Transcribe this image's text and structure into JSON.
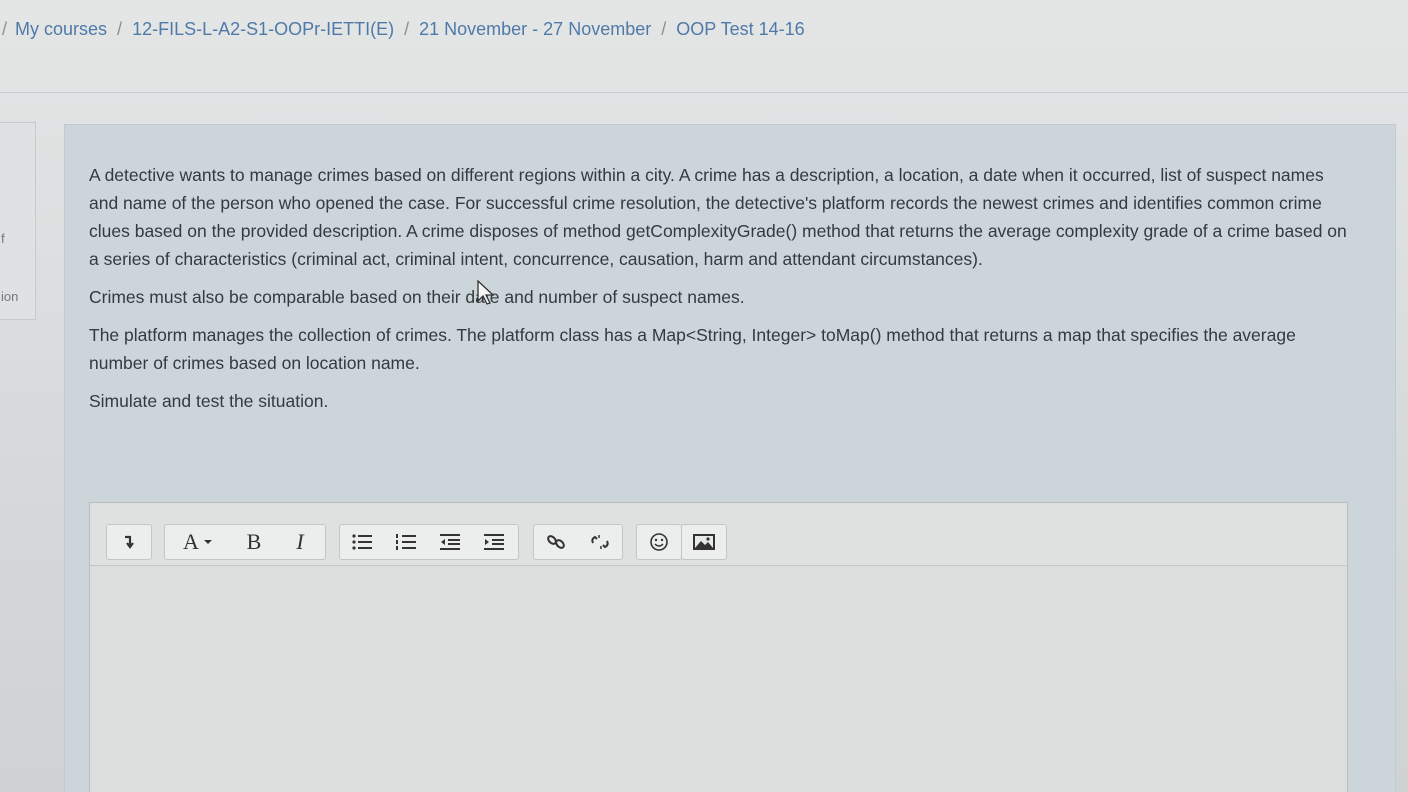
{
  "breadcrumb": {
    "items": [
      {
        "label": "My courses"
      },
      {
        "label": "12-FILS-L-A2-S1-OOPr-IETTI(E)"
      },
      {
        "label": "21 November - 27 November"
      },
      {
        "label": "OOP Test 14-16"
      }
    ],
    "separator": "/"
  },
  "sidebar_fragments": {
    "frag1": "f",
    "frag2": "ion"
  },
  "question": {
    "paragraphs": [
      "A detective wants to manage crimes based on different regions within a city. A crime has a description, a location, a date when it occurred, list of suspect names and name of the person who opened the case. For successful crime resolution, the detective's platform records the newest crimes and identifies common crime clues based on the provided description. A crime disposes of method getComplexityGrade() method that returns the average complexity grade of a crime based on a series of characteristics (criminal act, criminal intent, concurrence, causation, harm and attendant circumstances).",
      "Crimes must also be comparable based on their date and number of suspect names.",
      "The platform manages the collection of crimes. The platform class has a Map<String, Integer> toMap() method that returns a map that specifies the average number of crimes based on location name.",
      "Simulate and test the situation."
    ]
  },
  "editor": {
    "toolbar": {
      "collapse_icon": "collapse-arrow-icon",
      "font_label": "A",
      "bold_label": "B",
      "italic_label": "I",
      "unordered_list_icon": "unordered-list-icon",
      "ordered_list_icon": "ordered-list-icon",
      "outdent_icon": "outdent-icon",
      "indent_icon": "indent-icon",
      "link_icon": "link-icon",
      "unlink_icon": "unlink-icon",
      "emoji_icon": "emoji-icon",
      "image_icon": "image-icon"
    },
    "content": ""
  },
  "colors": {
    "link": "#4f79a8",
    "panel": "#ccd6da",
    "text": "#333a40"
  }
}
